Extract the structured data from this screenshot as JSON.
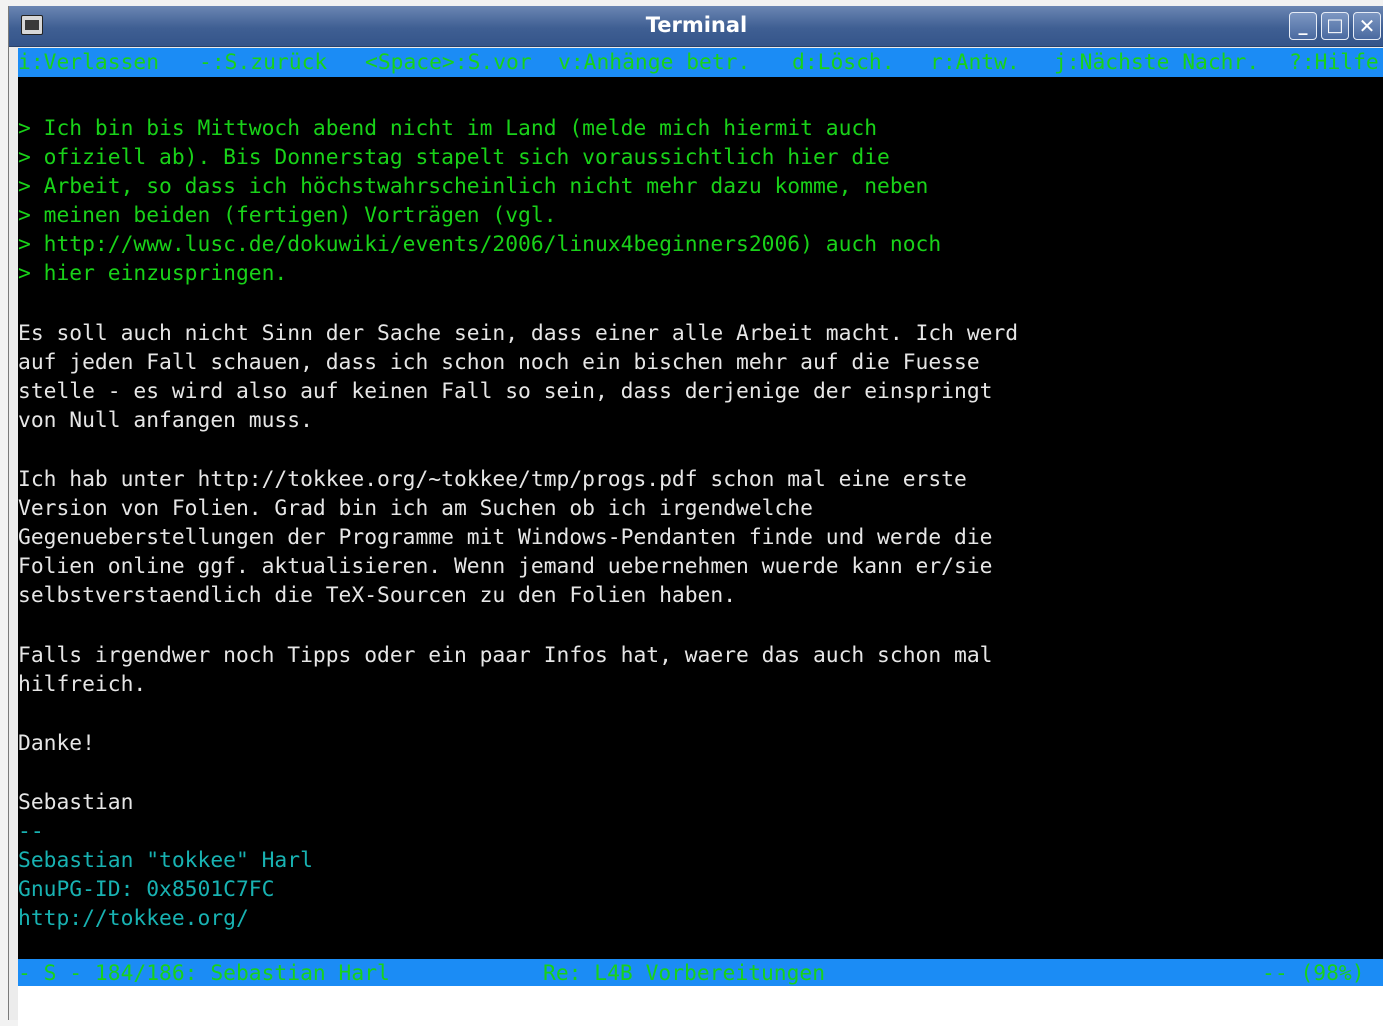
{
  "window": {
    "title": "Terminal",
    "menu_icon": "window-menu-icon",
    "buttons": {
      "minimize": "_",
      "maximize": "□",
      "close": "✕"
    }
  },
  "help_bar": {
    "items": [
      "i:Verlassen",
      "-:S.zurück",
      "<Space>:S.vor",
      "v:Anhänge betr.",
      "d:Lösch.",
      "r:Antw.",
      "j:Nächste Nachr.",
      "?:Hilfe"
    ]
  },
  "message": {
    "quoted": [
      "> Ich bin bis Mittwoch abend nicht im Land (melde mich hiermit auch",
      "> ofiziell ab). Bis Donnerstag stapelt sich voraussichtlich hier die",
      "> Arbeit, so dass ich höchstwahrscheinlich nicht mehr dazu komme, neben",
      "> meinen beiden (fertigen) Vorträgen (vgl.",
      "> http://www.lusc.de/dokuwiki/events/2006/linux4beginners2006) auch noch",
      "> hier einzuspringen."
    ],
    "paragraph1": [
      "Es soll auch nicht Sinn der Sache sein, dass einer alle Arbeit macht. Ich werd",
      "auf jeden Fall schauen, dass ich schon noch ein bischen mehr auf die Fuesse",
      "stelle - es wird also auf keinen Fall so sein, dass derjenige der einspringt",
      "von Null anfangen muss."
    ],
    "paragraph2": [
      "Ich hab unter http://tokkee.org/~tokkee/tmp/progs.pdf schon mal eine erste",
      "Version von Folien. Grad bin ich am Suchen ob ich irgendwelche",
      "Gegenueberstellungen der Programme mit Windows-Pendanten finde und werde die",
      "Folien online ggf. aktualisieren. Wenn jemand uebernehmen wuerde kann er/sie",
      "selbstverstaendlich die TeX-Sourcen zu den Folien haben."
    ],
    "paragraph3": [
      "Falls irgendwer noch Tipps oder ein paar Infos hat, waere das auch schon mal",
      "hilfreich."
    ],
    "thanks": "Danke!",
    "name": "Sebastian",
    "signature": [
      "--",
      "Sebastian \"tokkee\" Harl",
      "GnuPG-ID: 0x8501C7FC",
      "http://tokkee.org/"
    ]
  },
  "status_bar": {
    "left": "- S - 184/186: Sebastian Harl",
    "subject": "Re: L4B Vorbereitungen",
    "right": "-- (98%)"
  },
  "colors": {
    "bar_bg": "#1b8cf5",
    "bar_fg": "#19d219",
    "quote": "#19d219",
    "body": "#e6e6e6",
    "signature": "#18b2b2",
    "terminal_bg": "#000000"
  }
}
